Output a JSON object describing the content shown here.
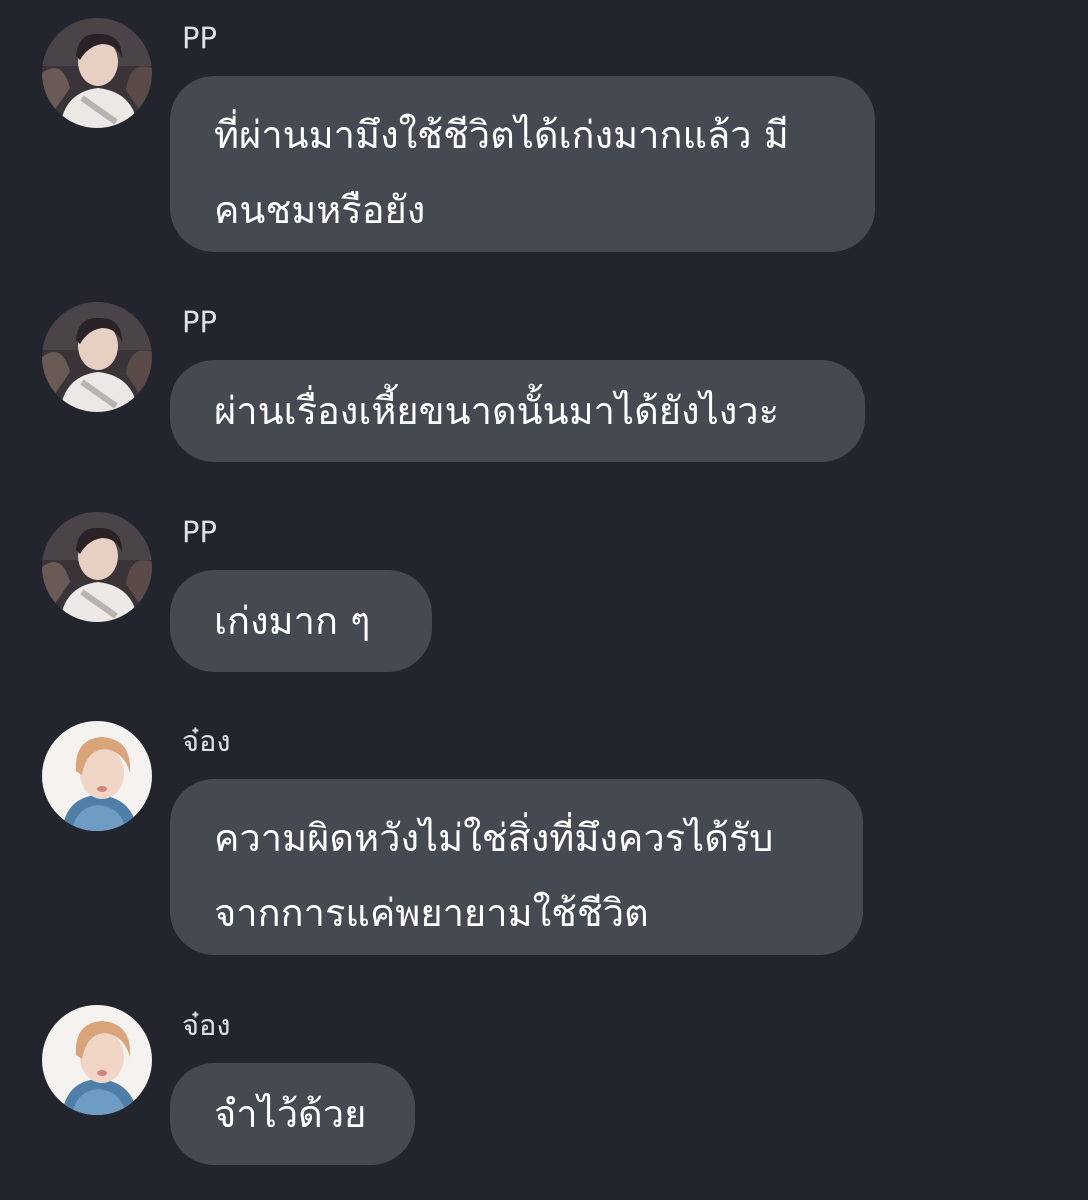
{
  "messages": [
    {
      "sender": "PP",
      "avatar": "pp-avatar",
      "lines": [
        "ที่ผ่านมามึงใช้ชีวิตได้เก่งมากแล้ว มี",
        "คนชมหรือยัง"
      ]
    },
    {
      "sender": "PP",
      "avatar": "pp-avatar",
      "lines": [
        "ผ่านเรื่องเหี้ยขนาดนั้นมาได้ยังไงวะ"
      ]
    },
    {
      "sender": "PP",
      "avatar": "pp-avatar",
      "lines": [
        "เก่งมาก ๆ"
      ]
    },
    {
      "sender": "จ๋อง",
      "avatar": "jong-avatar",
      "lines": [
        "ความผิดหวังไม่ใช่สิ่งที่มึงควรได้รับ",
        "จากการแค่พยายามใช้ชีวิต"
      ]
    },
    {
      "sender": "จ๋อง",
      "avatar": "jong-avatar",
      "lines": [
        "จำไว้ด้วย"
      ]
    }
  ],
  "colors": {
    "background": "#22252e",
    "bubble": "#454951",
    "text": "#ffffff",
    "sender": "#dfe1e6"
  }
}
